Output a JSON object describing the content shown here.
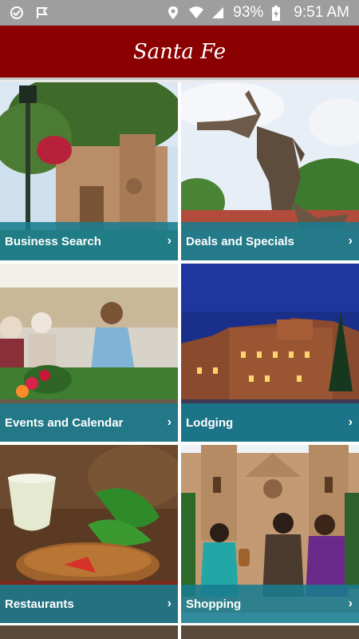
{
  "status_bar": {
    "battery": "93%",
    "time": "9:51 AM",
    "icons": [
      "check-circle-icon",
      "arrow-flag-icon",
      "location-pin-icon",
      "wifi-icon",
      "signal-icon",
      "battery-charging-icon"
    ]
  },
  "header": {
    "logo_text": "Santa Fe"
  },
  "tiles": [
    {
      "label": "Business Search",
      "chevron": "›",
      "photo": "cathedral-street"
    },
    {
      "label": "Deals and Specials",
      "chevron": "›",
      "photo": "bronze-statue"
    },
    {
      "label": "Events and Calendar",
      "chevron": "›",
      "photo": "farmers-market"
    },
    {
      "label": "Lodging",
      "chevron": "›",
      "photo": "adobe-hotel-night"
    },
    {
      "label": "Restaurants",
      "chevron": "›",
      "photo": "food-plate"
    },
    {
      "label": "Shopping",
      "chevron": "›",
      "photo": "shoppers-cathedral"
    }
  ],
  "colors": {
    "header_red": "#8b0000",
    "status_gray": "#9e9e9e",
    "teal_bar": "#187c90"
  }
}
